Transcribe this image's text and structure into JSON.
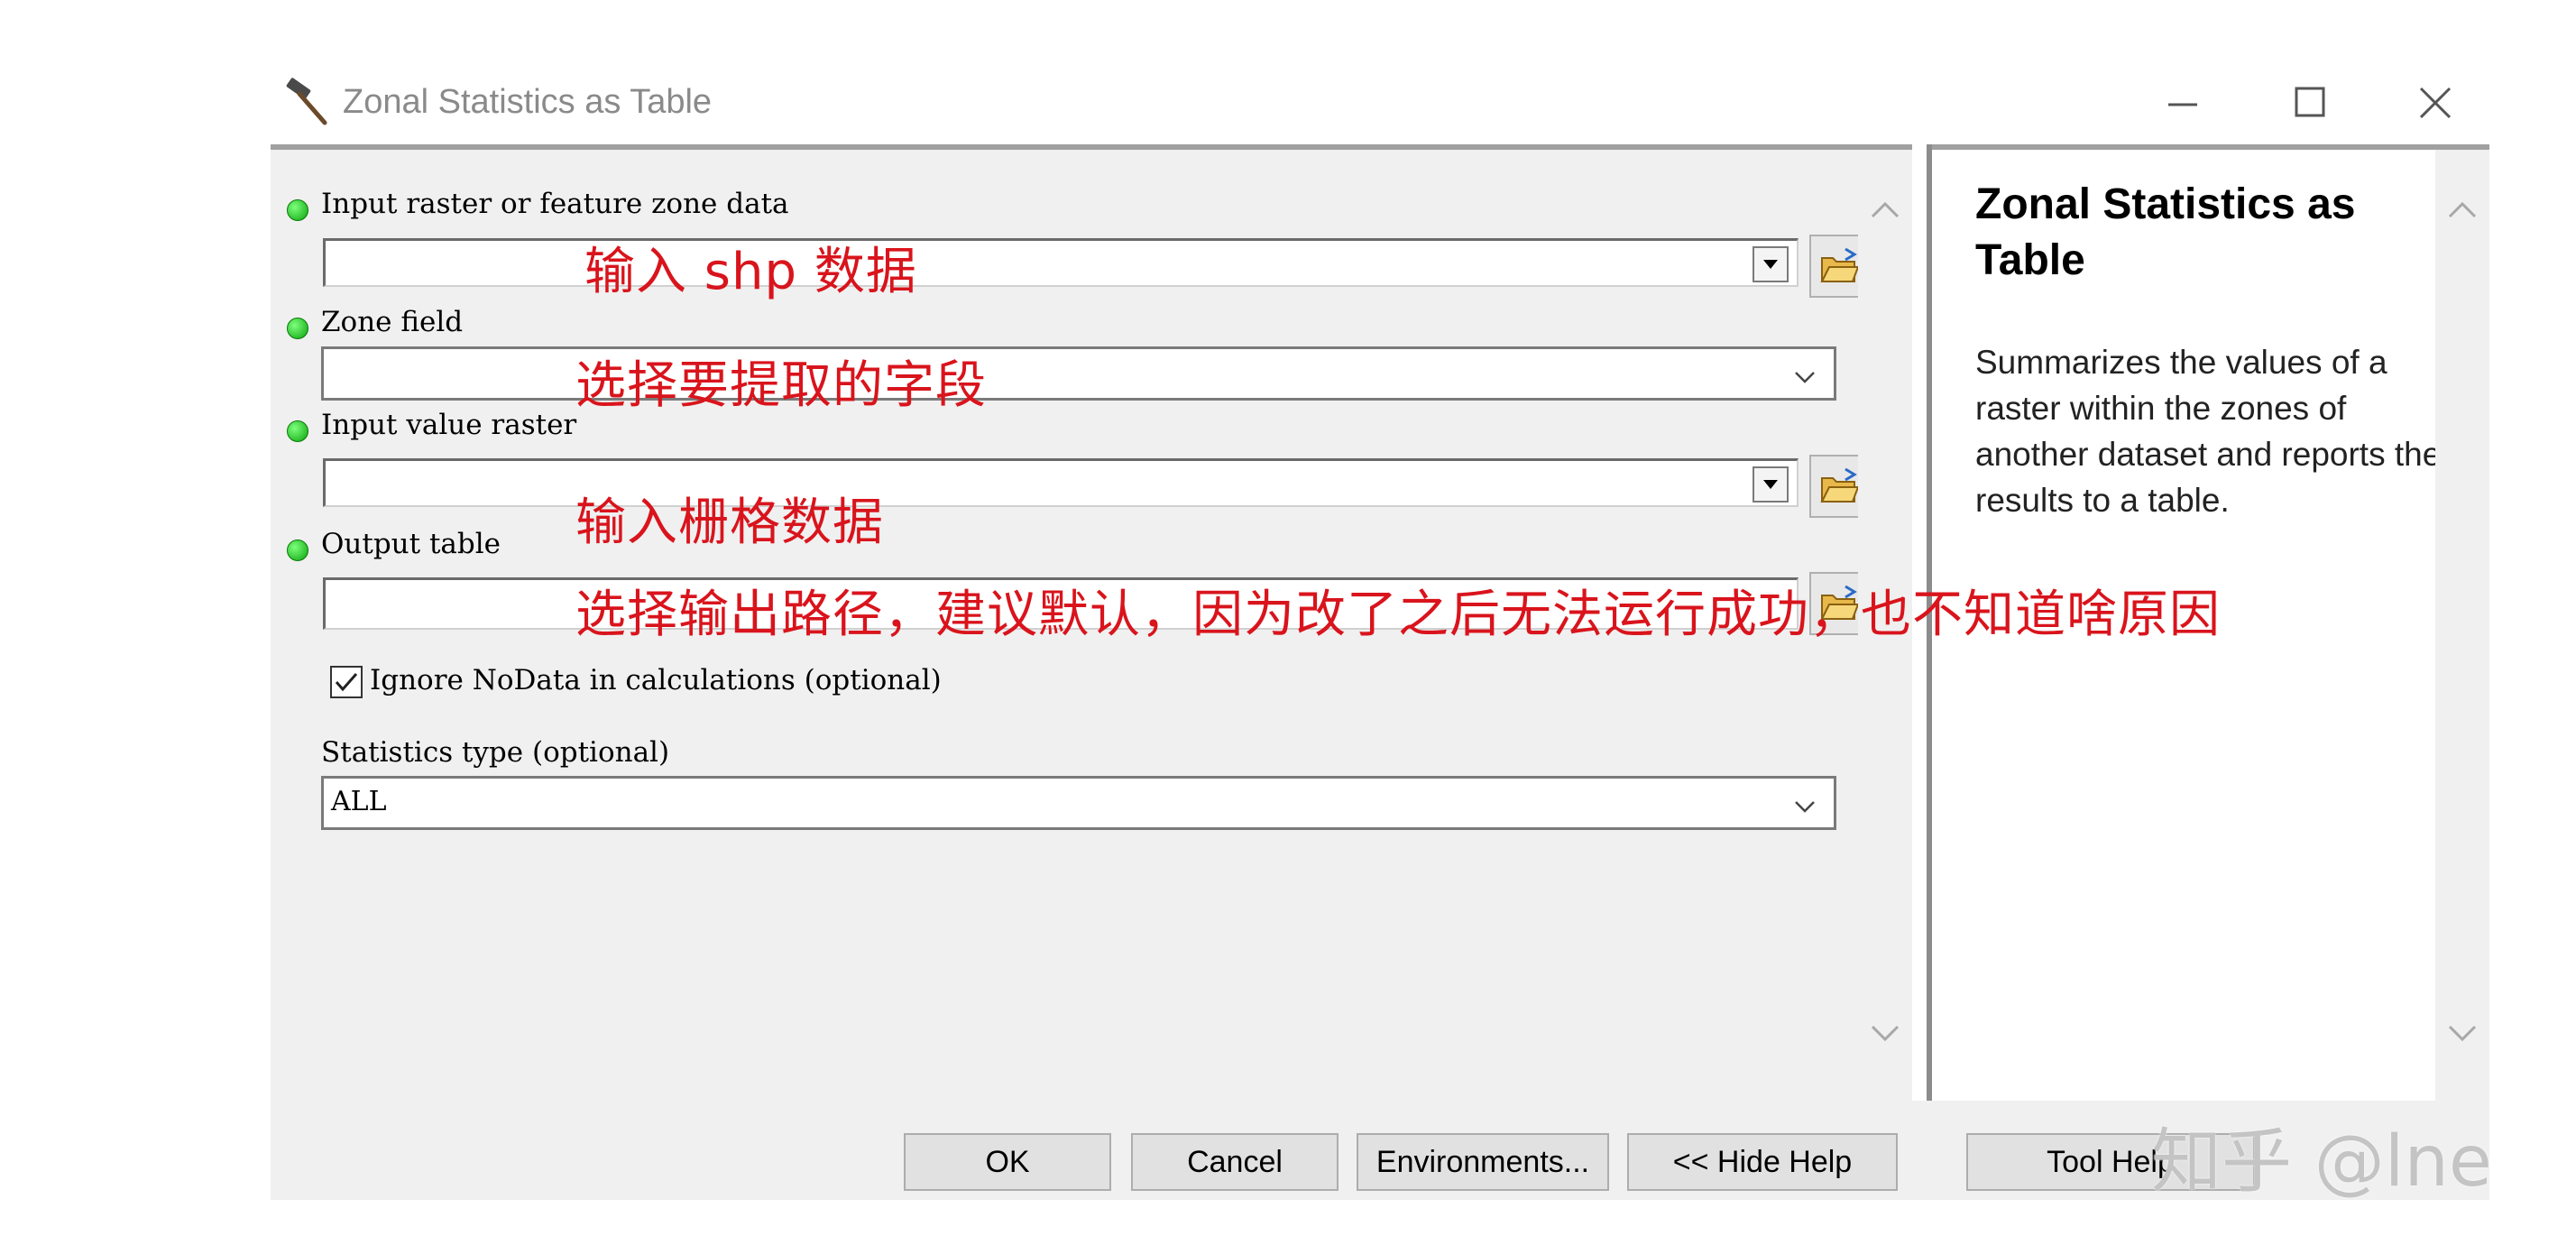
{
  "window": {
    "title": "Zonal Statistics as Table"
  },
  "params": {
    "input_zone": {
      "label": "Input raster or feature zone data",
      "value": ""
    },
    "zone_field": {
      "label": "Zone field",
      "value": ""
    },
    "input_value_raster": {
      "label": "Input value raster",
      "value": ""
    },
    "output_table": {
      "label": "Output table",
      "value": ""
    },
    "ignore_nodata": {
      "label": "Ignore NoData in calculations (optional)",
      "checked": true
    },
    "statistics_type": {
      "label": "Statistics type (optional)",
      "value": "ALL"
    }
  },
  "annotations": {
    "a1": "输入 shp 数据",
    "a2": "选择要提取的字段",
    "a3": "输入栅格数据",
    "a4": "选择输出路径，建议默认，因为改了之后无法运行成功，也不知道啥原因"
  },
  "help": {
    "title": "Zonal Statistics as Table",
    "body": "Summarizes the values of a raster within the zones of another dataset and reports the results to a table."
  },
  "buttons": {
    "ok": "OK",
    "cancel": "Cancel",
    "environments": "Environments...",
    "hide_help": "<< Hide Help",
    "tool_help": "Tool Help"
  },
  "watermark": "知乎 @lne",
  "colors": {
    "annotation": "#d9141c",
    "required_dot": "#0aa30a"
  }
}
